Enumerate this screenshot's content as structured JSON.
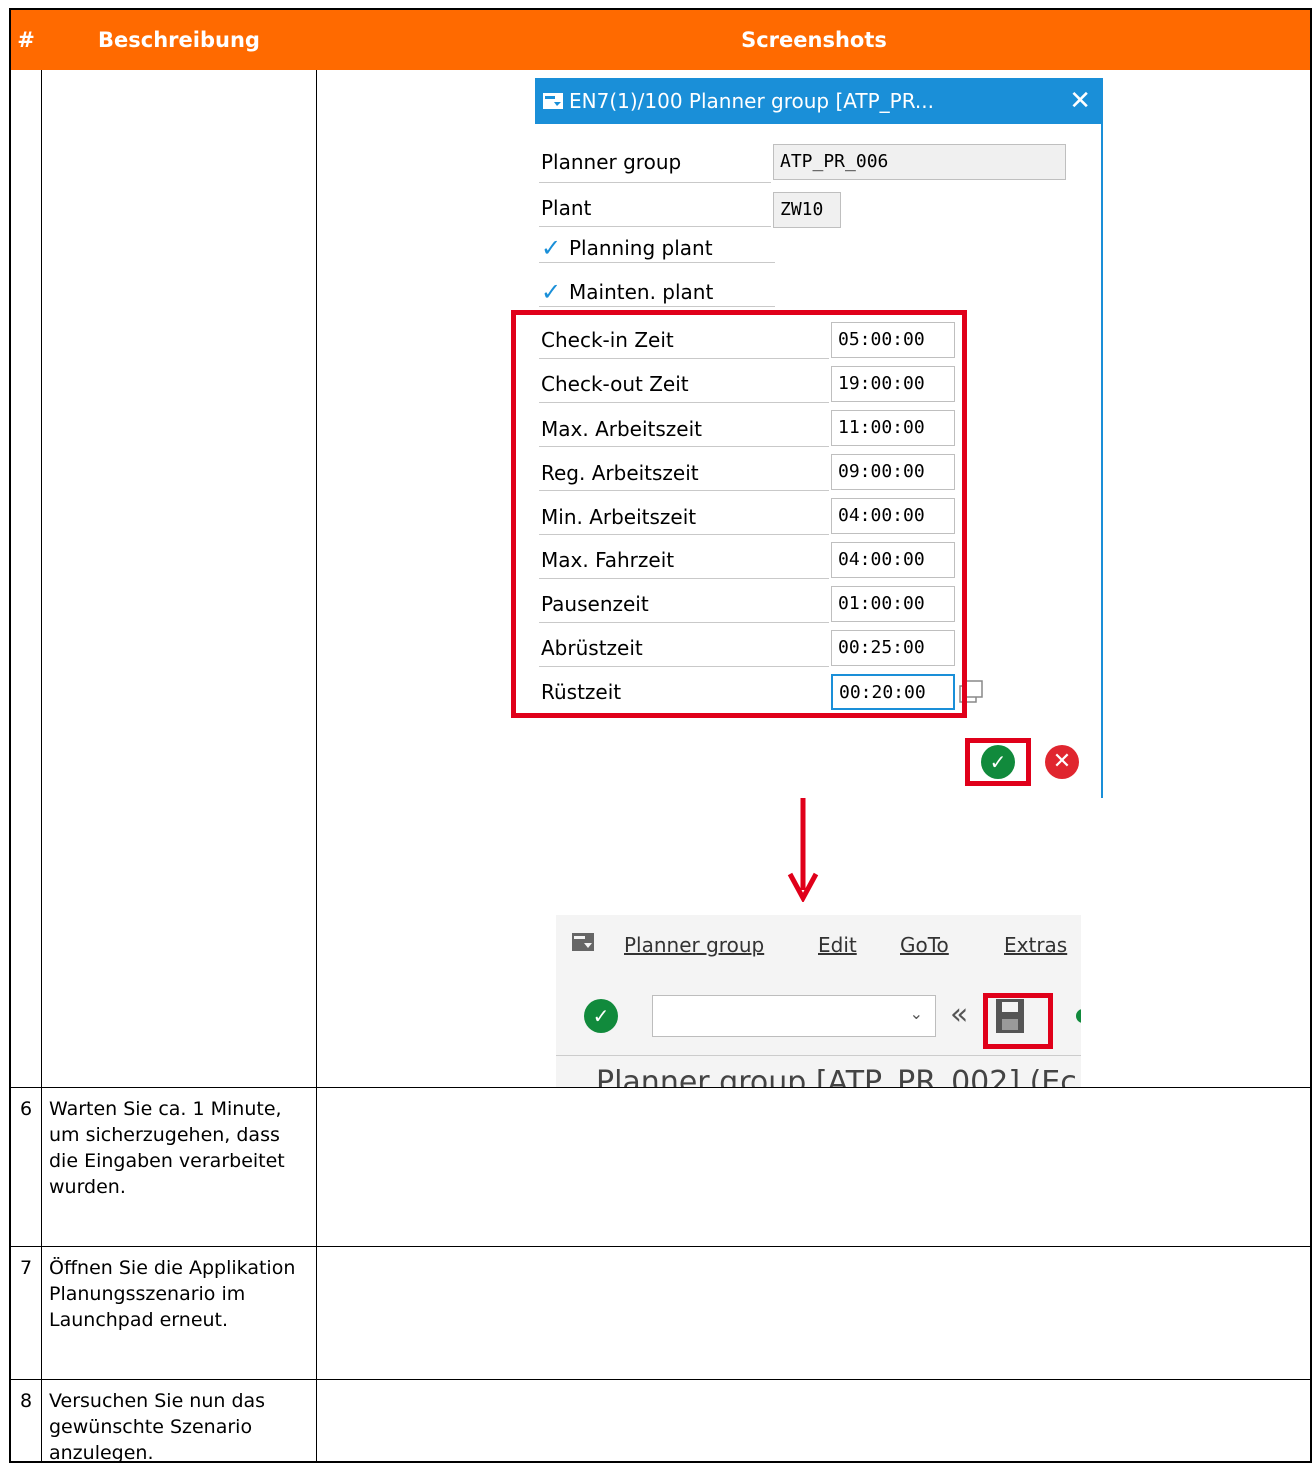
{
  "table": {
    "headers": {
      "num": "#",
      "description": "Beschreibung",
      "screenshots": "Screenshots"
    },
    "rows": [
      {
        "num": "6",
        "description": "Warten Sie ca. 1 Minute, um sicherzugehen, dass die Eingaben verarbeitet wurden."
      },
      {
        "num": "7",
        "description": "Öffnen Sie die Applikation Planungsszenario im Launchpad erneut."
      },
      {
        "num": "8",
        "description": "Versuchen Sie nun das gewünschte Szenario anzulegen."
      }
    ]
  },
  "dialog": {
    "title": "EN7(1)/100 Planner group [ATP_PR...",
    "fields": {
      "planner_group": {
        "label": "Planner group",
        "value": "ATP_PR_006"
      },
      "plant": {
        "label": "Plant",
        "value": "ZW10"
      },
      "planning_plant": {
        "label": "Planning plant",
        "checked": true
      },
      "mainten_plant": {
        "label": "Mainten. plant",
        "checked": true
      }
    },
    "times": [
      {
        "label": "Check-in Zeit",
        "value": "05:00:00"
      },
      {
        "label": "Check-out Zeit",
        "value": "19:00:00"
      },
      {
        "label": "Max. Arbeitszeit",
        "value": "11:00:00"
      },
      {
        "label": "Reg. Arbeitszeit",
        "value": "09:00:00"
      },
      {
        "label": "Min. Arbeitszeit",
        "value": "04:00:00"
      },
      {
        "label": "Max. Fahrzeit",
        "value": "04:00:00"
      },
      {
        "label": "Pausenzeit",
        "value": "01:00:00"
      },
      {
        "label": "Abrüstzeit",
        "value": "00:25:00"
      },
      {
        "label": "Rüstzeit",
        "value": "00:20:00"
      }
    ],
    "close_glyph": "✕",
    "confirm_glyph": "✓",
    "cancel_glyph": "✕"
  },
  "arrow_glyph": "↓",
  "second_screen": {
    "menu": {
      "planner_group": "Planner group",
      "edit": "Edit",
      "goto": "GoTo",
      "extras": "Extras"
    },
    "chevrons": "«",
    "combo_arrow": "⌄",
    "cut_text": "Planner group [ATP_PR_002] (Ec"
  },
  "colors": {
    "header_orange": "#ff6a00",
    "sap_blue": "#1a8fd8",
    "highlight_red": "#e0001a",
    "ok_green": "#118a3c"
  }
}
